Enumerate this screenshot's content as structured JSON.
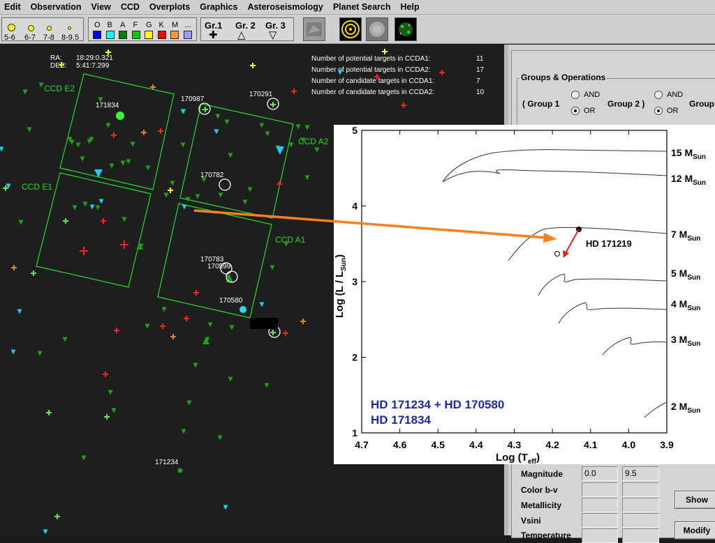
{
  "menu": [
    "Edit",
    "Observation",
    "View",
    "CCD",
    "Overplots",
    "Graphics",
    "Asteroseismology",
    "Planet Search",
    "Help"
  ],
  "toolbar": {
    "magnitudes": [
      "5-6",
      "6-7",
      "7-8",
      "8-9.5"
    ],
    "spectral_types": [
      {
        "label": "O",
        "color": "#0000ff"
      },
      {
        "label": "B",
        "color": "#00ffff"
      },
      {
        "label": "A",
        "color": "#008000"
      },
      {
        "label": "F",
        "color": "#00cc00"
      },
      {
        "label": "G",
        "color": "#ffff00"
      },
      {
        "label": "K",
        "color": "#ff0000"
      },
      {
        "label": "M",
        "color": "#ff9933"
      },
      {
        "label": "...",
        "color": "#9999ff"
      }
    ],
    "groups": [
      {
        "label": "Gr.1",
        "symbol": "✚"
      },
      {
        "label": "Gr. 2",
        "symbol": "△"
      },
      {
        "label": "Gr. 3",
        "symbol": "▽"
      }
    ]
  },
  "sky": {
    "ra_label": "RA:",
    "ra_value": "18:29:0.321",
    "dec_label": "DEC:",
    "dec_value": "5:41:7.299",
    "info": [
      {
        "label": "Number of potential targets in CCDA1:",
        "value": "11"
      },
      {
        "label": "Number of potential targets in CCDA2:",
        "value": "17"
      },
      {
        "label": "Number of candidate targets in CCDA1:",
        "value": "7"
      },
      {
        "label": "Number of candidate targets in CCDA2:",
        "value": "10"
      }
    ],
    "ccd_labels": [
      "CCD E2",
      "CCD A2",
      "CCD E1",
      "CCD A1"
    ],
    "star_ids": [
      "171834",
      "170987",
      "170291",
      "170782",
      "170783",
      "170599",
      "170580",
      "171234"
    ]
  },
  "panel": {
    "groups_title": "Groups & Operations",
    "group1": "( Group 1",
    "group2": "Group 2 )",
    "group3": "Group",
    "and": "AND",
    "or": "OR",
    "rows": [
      {
        "label": "Magnitude",
        "min": "0.0",
        "max": "9.5"
      },
      {
        "label": "Color b-v",
        "min": "",
        "max": ""
      },
      {
        "label": "Metallicity",
        "min": "",
        "max": ""
      },
      {
        "label": "Vsini",
        "min": "",
        "max": ""
      },
      {
        "label": "Temperature",
        "min": "",
        "max": ""
      }
    ],
    "show_button": "Show",
    "modify_button": "Modify"
  },
  "hrd": {
    "xlabel": "Log (T",
    "xlabel_sub": "eff",
    "xlabel_end": ")",
    "ylabel": "Log (L / L",
    "ylabel_sub": "Sun",
    "ylabel_end": ")",
    "x_ticks": [
      "4.7",
      "4.6",
      "4.5",
      "4.4",
      "4.3",
      "4.2",
      "4.1",
      "4.0",
      "3.9"
    ],
    "y_ticks": [
      "1",
      "2",
      "3",
      "4",
      "5"
    ],
    "tracks": [
      {
        "mass": "15",
        "label": "15 M"
      },
      {
        "mass": "12",
        "label": "12 M"
      },
      {
        "mass": "7",
        "label": "7 M"
      },
      {
        "mass": "5",
        "label": "5 M"
      },
      {
        "mass": "4",
        "label": "4 M"
      },
      {
        "mass": "3",
        "label": "3 M"
      },
      {
        "mass": "2",
        "label": "2 M"
      }
    ],
    "msun_sub": "Sun",
    "star_label": "HD 171219",
    "legend_line1": "HD 171234 + HD 170580",
    "legend_line2": "HD 171834"
  }
}
